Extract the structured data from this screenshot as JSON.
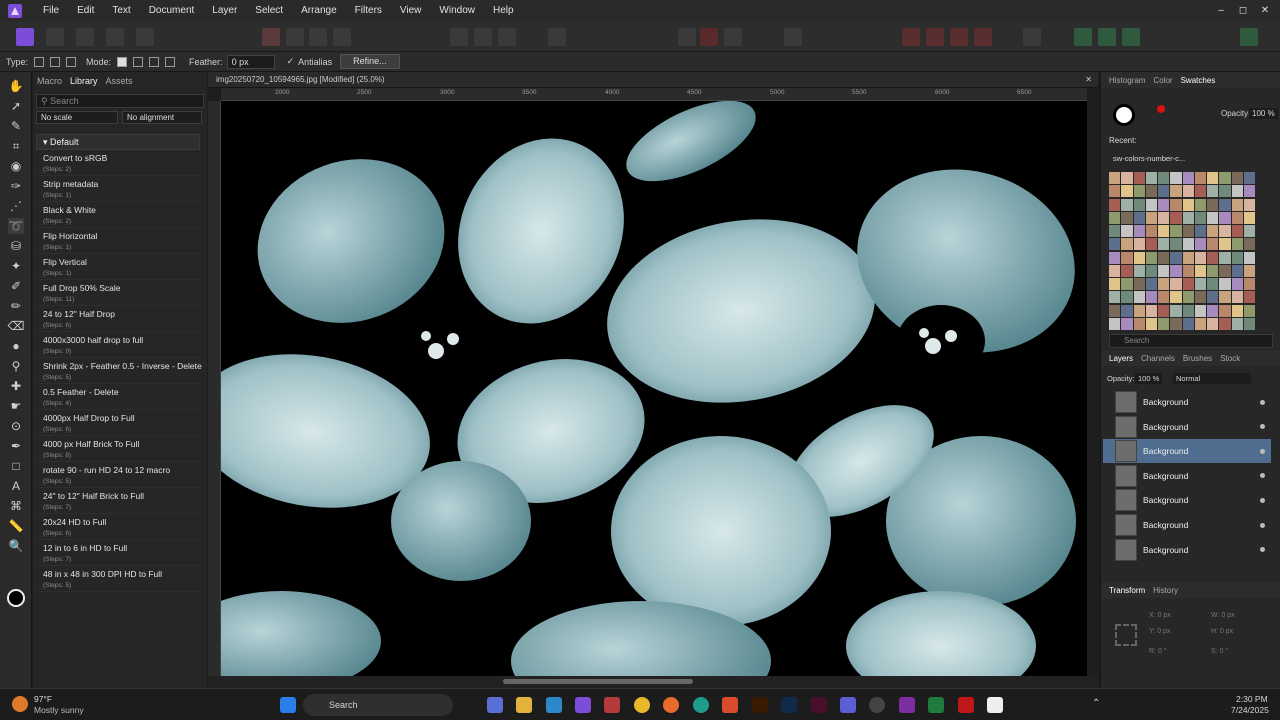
{
  "menubar": {
    "items": [
      "File",
      "Edit",
      "Text",
      "Document",
      "Layer",
      "Select",
      "Arrange",
      "Filters",
      "View",
      "Window",
      "Help"
    ],
    "window_controls": [
      "–",
      "◻",
      "✕"
    ]
  },
  "context": {
    "type_label": "Type:",
    "mode_label": "Mode:",
    "feather_label": "Feather:",
    "feather_value": "0 px",
    "antialias_label": "Antialias",
    "refine_label": "Refine..."
  },
  "left_panel": {
    "tabs": [
      "Macro",
      "Library",
      "Assets"
    ],
    "active_tab": "Library",
    "search_placeholder": "Search",
    "scale_option": "No scale",
    "align_option": "No alignment",
    "category": "Default",
    "macros": [
      {
        "name": "Convert to sRGB",
        "steps": "(Steps: 2)"
      },
      {
        "name": "Strip metadata",
        "steps": "(Steps: 1)"
      },
      {
        "name": "Black & White",
        "steps": "(Steps: 2)"
      },
      {
        "name": "Flip Horizontal",
        "steps": "(Steps: 1)"
      },
      {
        "name": "Flip Vertical",
        "steps": "(Steps: 1)"
      },
      {
        "name": "Full Drop 50% Scale",
        "steps": "(Steps: 11)"
      },
      {
        "name": "24 to 12\" Half Drop",
        "steps": "(Steps: 6)"
      },
      {
        "name": "4000x3000 half drop to full",
        "steps": "(Steps: 9)"
      },
      {
        "name": "Shrink 2px - Feather 0.5 - Inverse - Delete",
        "steps": "(Steps: 5)"
      },
      {
        "name": "0.5 Feather - Delete",
        "steps": "(Steps: 4)"
      },
      {
        "name": "4000px Half Drop to Full",
        "steps": "(Steps: 6)"
      },
      {
        "name": "4000 px Half Brick To Full",
        "steps": "(Steps: 8)"
      },
      {
        "name": "rotate 90 - run HD 24 to 12 macro",
        "steps": "(Steps: 5)"
      },
      {
        "name": "24\" to 12\" Half Brick to Full",
        "steps": "(Steps: 7)"
      },
      {
        "name": "20x24 HD to Full",
        "steps": "(Steps: 6)"
      },
      {
        "name": "12 in to 6 in HD to Full",
        "steps": "(Steps: 7)"
      },
      {
        "name": "48 in x 48 in 300 DPI HD to Full",
        "steps": "(Steps: 5)"
      }
    ]
  },
  "document": {
    "title": "img20250720_10594965.jpg [Modified] (25.0%)",
    "ruler_ticks": [
      "2000",
      "2500",
      "3000",
      "3500",
      "4000",
      "4500",
      "5000",
      "5500",
      "6000",
      "6500"
    ]
  },
  "right_panel": {
    "color_tabs": [
      "Histogram",
      "Color",
      "Swatches"
    ],
    "active_color_tab": "Swatches",
    "opacity_label": "Opacity:",
    "opacity_value": "100 %",
    "recent_label": "Recent:",
    "palette_name": "sw-colors-number-c...",
    "search_placeholder": "Search",
    "layer_tabs": [
      "Layers",
      "Channels",
      "Brushes",
      "Stock"
    ],
    "active_layer_tab": "Layers",
    "layer_opacity_label": "Opacity:",
    "layer_opacity_value": "100 %",
    "blend_mode": "Normal",
    "layers": [
      "Background",
      "Background",
      "Background",
      "Background",
      "Background",
      "Background",
      "Background"
    ],
    "selected_layer_index": 2,
    "transform_tabs": [
      "Transform",
      "History"
    ],
    "transform_fields": {
      "x": "0 px",
      "y": "0 px",
      "w": "0 px",
      "h": "0 px",
      "r": "0 °",
      "s": "0 °"
    }
  },
  "taskbar": {
    "weather_temp": "97°F",
    "weather_desc": "Mostly sunny",
    "search_label": "Search",
    "time": "2:30 PM",
    "date": "7/24/2025"
  },
  "colors": {
    "accent": "#8b5cf6",
    "selected_layer": "#4f6d8e",
    "canvas_flower": "#a9c8cc"
  }
}
